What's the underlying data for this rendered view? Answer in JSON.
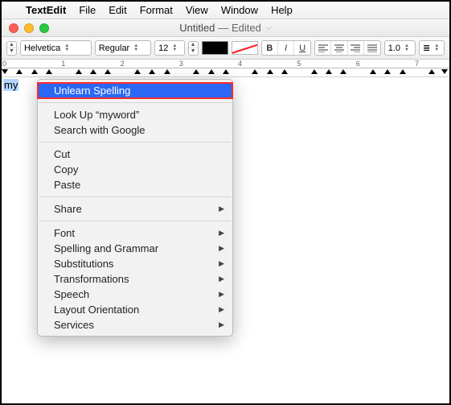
{
  "menubar": {
    "apple": "",
    "appname": "TextEdit",
    "items": [
      "File",
      "Edit",
      "Format",
      "View",
      "Window",
      "Help"
    ]
  },
  "window": {
    "title_doc": "Untitled",
    "title_status": "— Edited"
  },
  "toolbar": {
    "font_family": "Helvetica",
    "font_style": "Regular",
    "font_size": "12",
    "bold": "B",
    "italic": "I",
    "underline": "U",
    "spacing": "1.0",
    "list": "☰"
  },
  "ruler": {
    "numbers": [
      "0",
      "1",
      "2",
      "3",
      "4",
      "5",
      "6",
      "7"
    ]
  },
  "document": {
    "typed_text": "my"
  },
  "context_menu": {
    "groups": [
      [
        {
          "label": "Unlearn Spelling",
          "highlight": true,
          "submenu": false
        }
      ],
      [
        {
          "label": "Look Up “myword”",
          "submenu": false
        },
        {
          "label": "Search with Google",
          "submenu": false
        }
      ],
      [
        {
          "label": "Cut",
          "submenu": false
        },
        {
          "label": "Copy",
          "submenu": false
        },
        {
          "label": "Paste",
          "submenu": false
        }
      ],
      [
        {
          "label": "Share",
          "submenu": true
        }
      ],
      [
        {
          "label": "Font",
          "submenu": true
        },
        {
          "label": "Spelling and Grammar",
          "submenu": true
        },
        {
          "label": "Substitutions",
          "submenu": true
        },
        {
          "label": "Transformations",
          "submenu": true
        },
        {
          "label": "Speech",
          "submenu": true
        },
        {
          "label": "Layout Orientation",
          "submenu": true
        },
        {
          "label": "Services",
          "submenu": true
        }
      ]
    ]
  }
}
